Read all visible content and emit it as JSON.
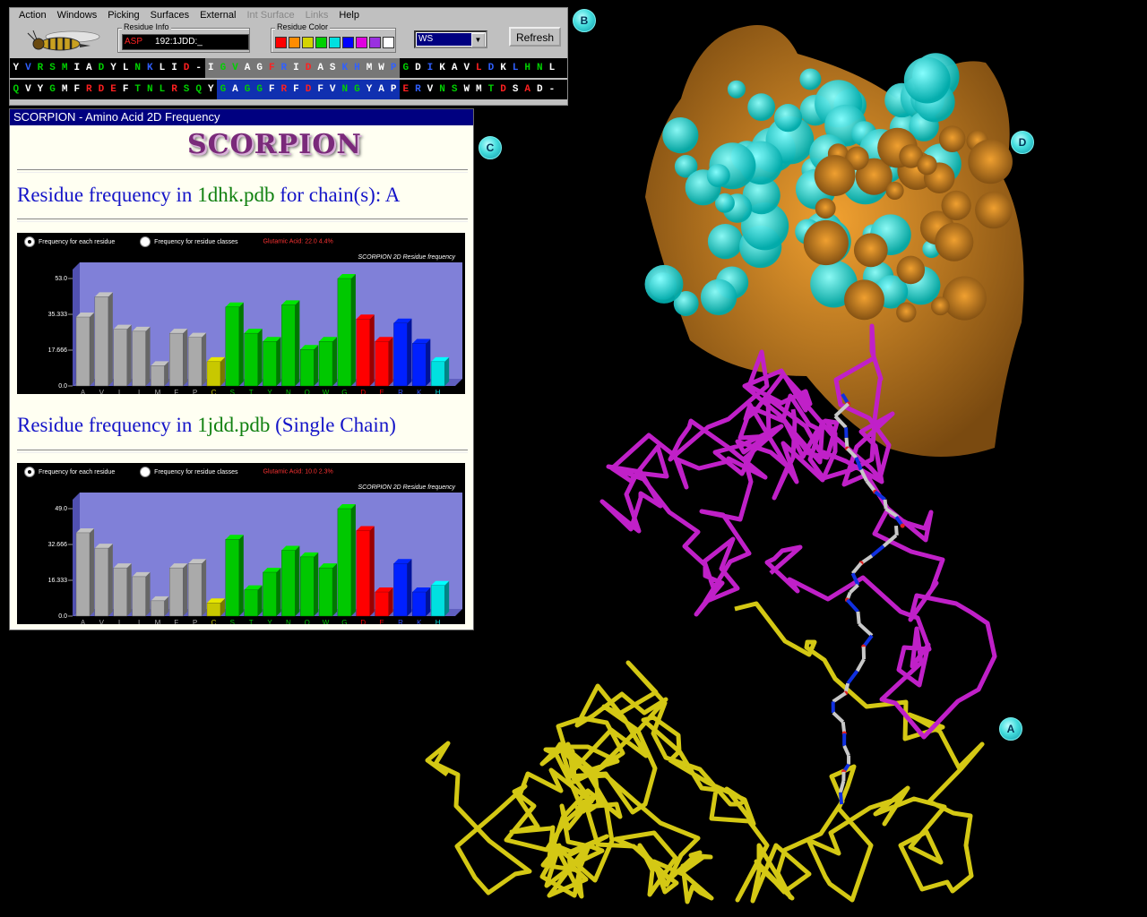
{
  "menu": {
    "items": [
      {
        "label": "Action",
        "enabled": true
      },
      {
        "label": "Windows",
        "enabled": true
      },
      {
        "label": "Picking",
        "enabled": true
      },
      {
        "label": "Surfaces",
        "enabled": true
      },
      {
        "label": "External",
        "enabled": true
      },
      {
        "label": "Int Surface",
        "enabled": false
      },
      {
        "label": "Links",
        "enabled": false
      },
      {
        "label": "Help",
        "enabled": true
      }
    ]
  },
  "toolbar": {
    "residue_info_label": "Residue Info",
    "residue_name": "ASP",
    "residue_id": "192:1JDD:_",
    "residue_color_label": "Residue Color",
    "swatches": [
      "#ff0000",
      "#ff8c00",
      "#d4d400",
      "#00d000",
      "#00e0e0",
      "#0000ff",
      "#e000e0",
      "#9a30e0",
      "#ffffff"
    ],
    "display_mode": "WS",
    "refresh_label": "Refresh"
  },
  "sequence": {
    "row1": "YVRSMIADYLNKLID-IGVAGFRIDASKHMWPGDIKAVLDKLHNL",
    "row1_colors": "wbgggwwgwwgbwwrwwggwwrbwrwwbbwwbgwbwwwrbwbggw",
    "row1_bg": "................gggggggggggggggg.............",
    "row2": "QVYGMFRDEFTNLRSQYGAGGFRFDFVNGYAPERVNSWMTDSAD-",
    "row2_colors": "gwwgwwrrrwgggrggwgwggwrwrwwggwwwrbwggwwgrwrw",
    "row2_bg": ".................bbbbbbbbbbbbbbb.............."
  },
  "markers": {
    "a": "A",
    "b": "B",
    "c": "C",
    "d": "D"
  },
  "scorpion": {
    "window_title": "SCORPION - Amino Acid 2D Frequency",
    "logo_text": "SCORPION",
    "heading1_prefix": "Residue frequency in ",
    "heading1_file": "1dhk.pdb",
    "heading1_suffix": " for chain(s): A",
    "heading2_prefix": "Residue frequency in ",
    "heading2_file": "1jdd.pdb",
    "heading2_suffix": " (Single Chain)",
    "radio_each": "Frequency for each residue",
    "radio_classes": "Frequency for residue classes",
    "chart1_status": "Glutamic Acid: 22.0    4.4%",
    "chart2_status": "Glutamic Acid: 10.0    2.3%"
  },
  "chart_data": [
    {
      "type": "bar",
      "title": "SCORPION 2D Residue frequency",
      "categories": [
        "A",
        "V",
        "L",
        "I",
        "M",
        "F",
        "P",
        "C",
        "S",
        "T",
        "Y",
        "N",
        "Q",
        "W",
        "G",
        "D",
        "E",
        "R",
        "K",
        "H"
      ],
      "category_colors": [
        "#aaaaaa",
        "#aaaaaa",
        "#aaaaaa",
        "#aaaaaa",
        "#aaaaaa",
        "#aaaaaa",
        "#aaaaaa",
        "#c8c800",
        "#00c800",
        "#00c800",
        "#00c800",
        "#00c800",
        "#00c800",
        "#00c800",
        "#00c800",
        "#ff0000",
        "#ff0000",
        "#0020ff",
        "#0020ff",
        "#00e0e0"
      ],
      "label_colors": [
        "#aaaaaa",
        "#aaaaaa",
        "#aaaaaa",
        "#aaaaaa",
        "#aaaaaa",
        "#aaaaaa",
        "#aaaaaa",
        "#c8c800",
        "#00c800",
        "#00c800",
        "#00c800",
        "#00c800",
        "#00c800",
        "#00c800",
        "#00c800",
        "#ff0000",
        "#ff0000",
        "#3050ff",
        "#3050ff",
        "#00e0e0"
      ],
      "values": [
        34,
        44,
        28,
        27,
        10,
        26,
        24,
        12,
        39,
        26,
        22,
        40,
        18,
        22,
        53,
        33,
        22,
        31,
        21,
        12
      ],
      "yticks": [
        "53.0",
        "35.333",
        "17.666",
        "0.0"
      ],
      "ylim": [
        0,
        53
      ]
    },
    {
      "type": "bar",
      "title": "SCORPION 2D Residue frequency",
      "categories": [
        "A",
        "V",
        "L",
        "I",
        "M",
        "F",
        "P",
        "C",
        "S",
        "T",
        "Y",
        "N",
        "Q",
        "W",
        "G",
        "D",
        "E",
        "R",
        "K",
        "H"
      ],
      "category_colors": [
        "#aaaaaa",
        "#aaaaaa",
        "#aaaaaa",
        "#aaaaaa",
        "#aaaaaa",
        "#aaaaaa",
        "#aaaaaa",
        "#c8c800",
        "#00c800",
        "#00c800",
        "#00c800",
        "#00c800",
        "#00c800",
        "#00c800",
        "#00c800",
        "#ff0000",
        "#ff0000",
        "#0020ff",
        "#0020ff",
        "#00e0e0"
      ],
      "label_colors": [
        "#aaaaaa",
        "#aaaaaa",
        "#aaaaaa",
        "#aaaaaa",
        "#aaaaaa",
        "#aaaaaa",
        "#aaaaaa",
        "#c8c800",
        "#00c800",
        "#00c800",
        "#00c800",
        "#00c800",
        "#00c800",
        "#00c800",
        "#00c800",
        "#ff0000",
        "#ff0000",
        "#3050ff",
        "#3050ff",
        "#00e0e0"
      ],
      "values": [
        38,
        31,
        22,
        18,
        7,
        22,
        24,
        6,
        35,
        12,
        20,
        30,
        27,
        22,
        49,
        39,
        11,
        24,
        11,
        14
      ],
      "yticks": [
        "49.0",
        "32.666",
        "16.333",
        "0.0"
      ],
      "ylim": [
        0,
        49
      ]
    }
  ]
}
